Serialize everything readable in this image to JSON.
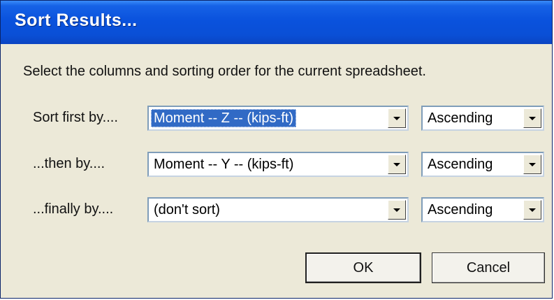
{
  "dialog": {
    "title": "Sort Results...",
    "instruction": "Select the columns and sorting order for the current spreadsheet."
  },
  "rows": [
    {
      "label": "Sort first by....",
      "column": "Moment -- Z -- (kips-ft)",
      "order": "Ascending"
    },
    {
      "label": "...then by....",
      "column": "Moment -- Y -- (kips-ft)",
      "order": "Ascending"
    },
    {
      "label": "...finally by....",
      "column": "(don't sort)",
      "order": "Ascending"
    }
  ],
  "buttons": {
    "ok": "OK",
    "cancel": "Cancel"
  },
  "colors": {
    "title_bar": "#0a52dd",
    "dialog_bg": "#ece9d8",
    "selection": "#316ac5"
  },
  "icons": [
    "dropdown-arrow-icon"
  ]
}
